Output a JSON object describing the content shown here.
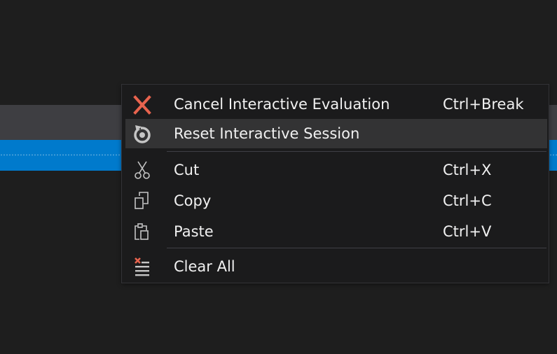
{
  "colors": {
    "background": "#1e1e1e",
    "band_grey": "#3e3e42",
    "band_blue": "#007acc",
    "menu_background": "#1b1b1c",
    "menu_highlight": "#333334",
    "cancel_icon": "#e8634e"
  },
  "context_menu": {
    "items": [
      {
        "label": "Cancel Interactive Evaluation",
        "shortcut": "Ctrl+Break",
        "icon": "cancel-x-icon",
        "highlighted": false
      },
      {
        "label": "Reset Interactive Session",
        "shortcut": "",
        "icon": "reset-icon",
        "highlighted": true
      },
      {
        "label": "Cut",
        "shortcut": "Ctrl+X",
        "icon": "scissors-icon",
        "highlighted": false
      },
      {
        "label": "Copy",
        "shortcut": "Ctrl+C",
        "icon": "copy-icon",
        "highlighted": false
      },
      {
        "label": "Paste",
        "shortcut": "Ctrl+V",
        "icon": "paste-icon",
        "highlighted": false
      },
      {
        "label": "Clear All",
        "shortcut": "",
        "icon": "clear-all-icon",
        "highlighted": false
      }
    ]
  }
}
